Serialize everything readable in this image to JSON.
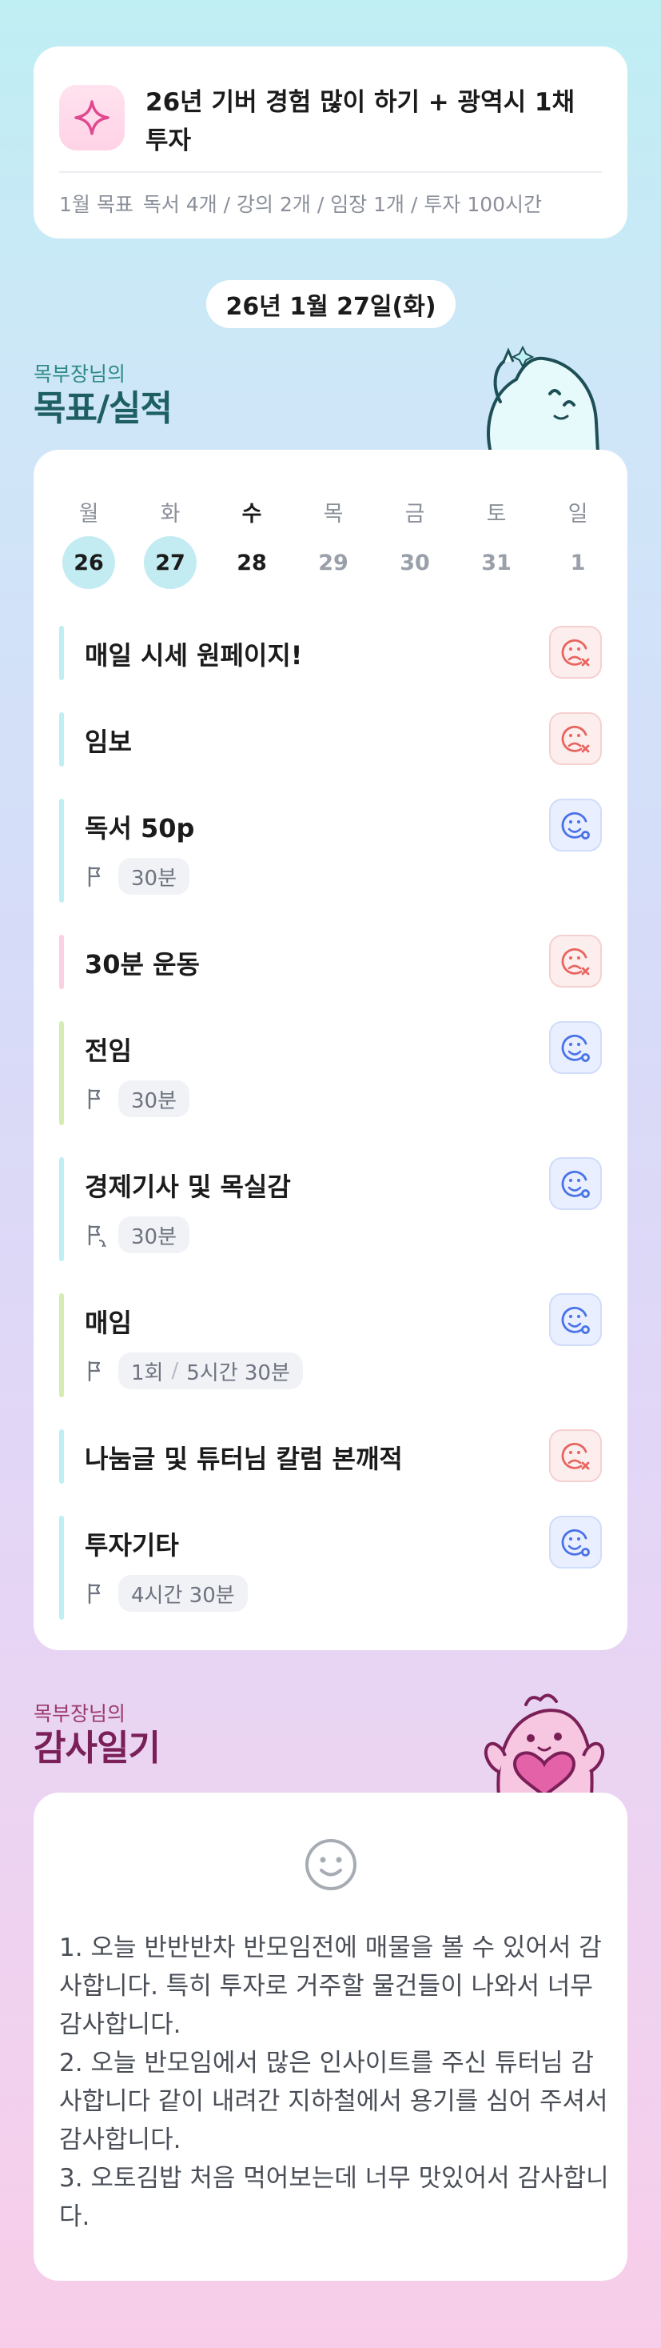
{
  "goal_card": {
    "title": "26년 기버 경험 많이 하기 + 광역시 1채 투자",
    "sub_label": "1월 목표",
    "sub_text": "독서 4개 / 강의 2개 / 임장 1개 / 투자 100시간"
  },
  "date": "26년 1월 27일(화)",
  "goals_section": {
    "small": "목부장님의",
    "big": "목표/실적"
  },
  "week": [
    {
      "day": "월",
      "num": "26",
      "state": "done"
    },
    {
      "day": "화",
      "num": "27",
      "state": "done"
    },
    {
      "day": "수",
      "num": "28",
      "state": "today"
    },
    {
      "day": "목",
      "num": "29",
      "state": "future"
    },
    {
      "day": "금",
      "num": "30",
      "state": "future"
    },
    {
      "day": "토",
      "num": "31",
      "state": "future"
    },
    {
      "day": "일",
      "num": "1",
      "state": "future"
    }
  ],
  "tasks": [
    {
      "name": "매일 시세 원페이지!",
      "status": "fail",
      "color": "#bfeef3"
    },
    {
      "name": "임보",
      "status": "fail",
      "color": "#bfeef3"
    },
    {
      "name": "독서 50p",
      "status": "ok",
      "color": "#bfeef3",
      "flag": "goal-flag-icon",
      "chip": "30분"
    },
    {
      "name": "30분 운동",
      "status": "fail",
      "color": "#fbd0e2"
    },
    {
      "name": "전임",
      "status": "ok",
      "color": "#d6ecb2",
      "flag": "goal-flag-icon",
      "chip": "30분"
    },
    {
      "name": "경제기사 및 목실감",
      "status": "ok",
      "color": "#bfeef3",
      "flag": "repeat-flag-icon",
      "chip": "30분"
    },
    {
      "name": "매임",
      "status": "ok",
      "color": "#d6ecb2",
      "flag": "goal-flag-icon",
      "chip": "1회",
      "chip2": "5시간 30분"
    },
    {
      "name": "나눔글 및 튜터님 칼럼 본깨적",
      "status": "fail",
      "color": "#bfeef3"
    },
    {
      "name": "투자기타",
      "status": "ok",
      "color": "#bfeef3",
      "flag": "goal-flag-icon",
      "chip": "4시간 30분"
    }
  ],
  "gratitude_section": {
    "small": "목부장님의",
    "big": "감사일기"
  },
  "gratitude": {
    "lines": [
      "1. 오늘 반반반차 반모임전에 매물을 볼 수 있어서 감사합니다. 특히 투자로 거주할 물건들이 나와서 너무 감사합니다.",
      "2. 오늘 반모임에서 많은 인사이트를 주신 튜터님 감사합니다 같이 내려간 지하철에서 용기를 심어 주셔서 감사합니다.",
      "3. 오토김밥 처음 먹어보는데 너무 맛있어서 감사합니다."
    ]
  },
  "colors": {
    "fail": "#e8645f",
    "ok": "#4a72e8",
    "done_day": "#c2ecf2"
  }
}
